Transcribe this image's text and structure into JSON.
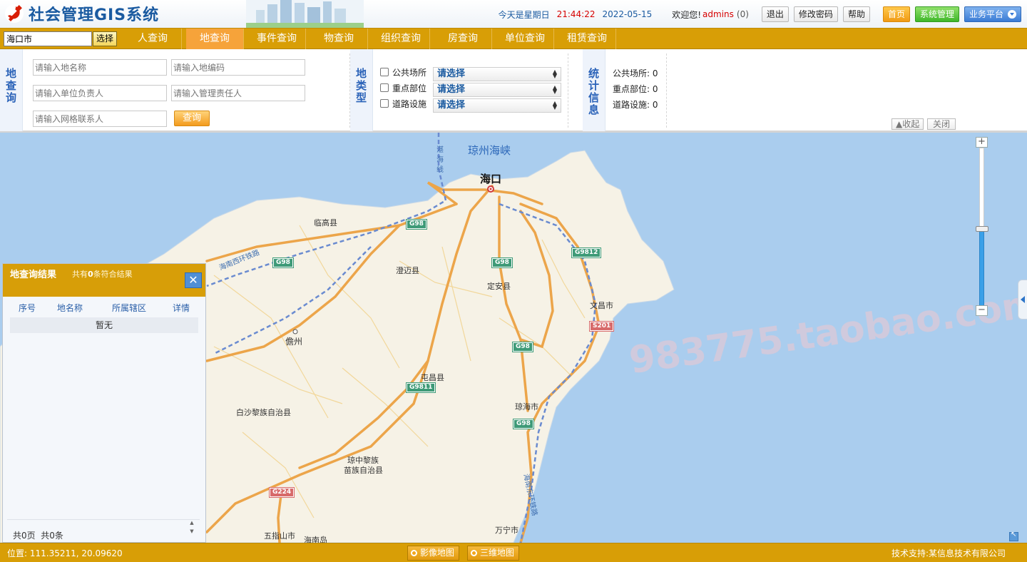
{
  "app": {
    "title": "社会管理GIS系统"
  },
  "header": {
    "date_label": "今天是星期日",
    "clock": "21:44:22",
    "date": "2022-05-15",
    "welcome": "欢迎您!",
    "username": "admins",
    "message_count": "(0)",
    "logout": "退出",
    "change_password": "修改密码",
    "help": "帮助",
    "home": "首页",
    "system_admin": "系统管理",
    "platform": "业务平台"
  },
  "nav": {
    "city_value": "海口市",
    "city_button": "选择",
    "tabs": [
      {
        "label": "人查询",
        "active": false
      },
      {
        "label": "地查询",
        "active": true
      },
      {
        "label": "事件查询",
        "active": false
      },
      {
        "label": "物查询",
        "active": false
      },
      {
        "label": "组织查询",
        "active": false
      },
      {
        "label": "房查询",
        "active": false
      },
      {
        "label": "单位查询",
        "active": false
      },
      {
        "label": "租赁查询",
        "active": false
      }
    ]
  },
  "query": {
    "section_label": "地查询",
    "placeholders": {
      "place_name": "请输入地名称",
      "place_code": "请输入地编码",
      "unit_leader": "请输入单位负责人",
      "manager": "请输入管理责任人",
      "grid_contact": "请输入网格联系人"
    },
    "query_button": "查询",
    "type_label": "地类型",
    "types": [
      {
        "label": "公共场所",
        "select": "请选择"
      },
      {
        "label": "重点部位",
        "select": "请选择"
      },
      {
        "label": "道路设施",
        "select": "请选择"
      }
    ],
    "stats_label": "统计信息",
    "stats": [
      {
        "label": "公共场所:",
        "value": "0"
      },
      {
        "label": "重点部位:",
        "value": "0"
      },
      {
        "label": "道路设施:",
        "value": "0"
      }
    ],
    "collapse_button": "▲收起",
    "close_button": "关闭"
  },
  "map": {
    "labels": {
      "strait": "琼州海峡",
      "haikou": "海口",
      "zhanhai": "湛海线",
      "lingao": "临高县",
      "chengmai": "澄迈县",
      "dingan": "定安县",
      "wenchang": "文昌市",
      "danzhou": "儋州",
      "tunchang": "屯昌县",
      "qionghai": "琼海市",
      "baisha": "白沙黎族自治县",
      "qiongzhong_1": "琼中黎族",
      "qiongzhong_2": "苗族自治县",
      "wuzhishan": "五指山市",
      "hainandao": "海南岛",
      "wanning": "万宁市",
      "west_rail": "海南西环铁路",
      "east_rail": "海南东环铁路"
    },
    "shields": {
      "g98_a": "G98",
      "g98_b": "G98",
      "g98_c": "G98",
      "g98_d": "G98",
      "g98_e": "G98",
      "g9812": "G9812",
      "s201": "S201",
      "g9811": "G9811",
      "g224": "G224"
    },
    "watermark": "983775.taobao.com",
    "colors": {
      "sea": "#aacdee",
      "land": "#f6f2e6",
      "highway": "#eca54a",
      "rail": "#6a8bd0"
    }
  },
  "results": {
    "title": "地查询结果",
    "count_prefix": "共有",
    "count": "0",
    "count_suffix": "条符合结果",
    "columns": [
      "序号",
      "地名称",
      "所属辖区",
      "详情"
    ],
    "empty": "暂无",
    "pages": "共0页",
    "records": "共0条"
  },
  "statusbar": {
    "coords_label": "位置:",
    "coords_value": "111.35211, 20.09620",
    "image_map": "影像地图",
    "map_3d": "三维地图",
    "tech_support": "技术支持:某信息技术有限公司"
  }
}
